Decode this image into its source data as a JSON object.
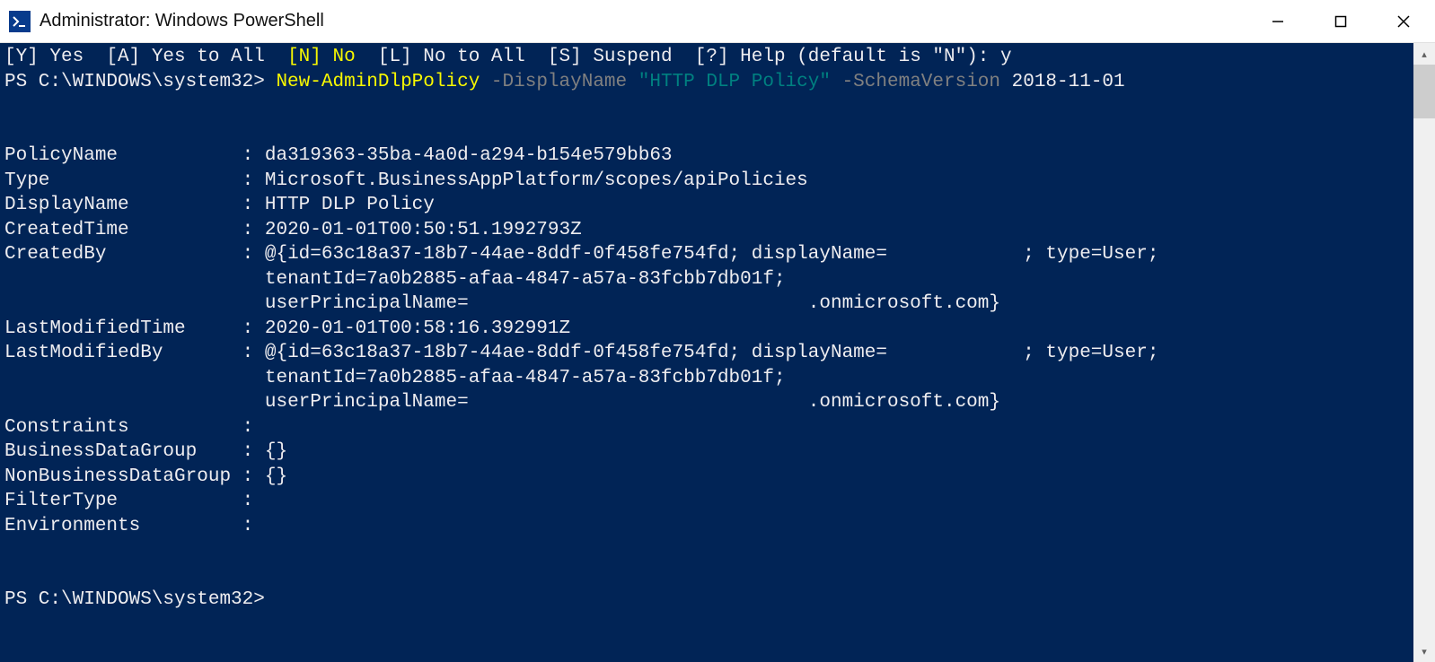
{
  "window": {
    "title": "Administrator: Windows PowerShell"
  },
  "prompt1": {
    "options": "[Y] Yes  [A] Yes to All  ",
    "highlight": "[N] No",
    "rest": "  [L] No to All  [S] Suspend  [?] Help (default is \"N\"): y"
  },
  "cmdline": {
    "prompt": "PS C:\\WINDOWS\\system32> ",
    "cmd": "New-AdminDlpPolicy ",
    "p1": "-DisplayName ",
    "v1": "\"HTTP DLP Policy\" ",
    "p2": "-SchemaVersion ",
    "v2": "2018-11-01"
  },
  "output": {
    "PolicyName": "da319363-35ba-4a0d-a294-b154e579bb63",
    "Type": "Microsoft.BusinessAppPlatform/scopes/apiPolicies",
    "DisplayName": "HTTP DLP Policy",
    "CreatedTime": "2020-01-01T00:50:51.1992793Z",
    "CreatedBy_l1": "@{id=63c18a37-18b7-44ae-8ddf-0f458fe754fd; displayName=            ; type=User;",
    "CreatedBy_l2": "tenantId=7a0b2885-afaa-4847-a57a-83fcbb7db01f;",
    "CreatedBy_l3": "userPrincipalName=                              .onmicrosoft.com}",
    "LastModifiedTime": "2020-01-01T00:58:16.392991Z",
    "LastModifiedBy_l1": "@{id=63c18a37-18b7-44ae-8ddf-0f458fe754fd; displayName=            ; type=User;",
    "LastModifiedBy_l2": "tenantId=7a0b2885-afaa-4847-a57a-83fcbb7db01f;",
    "LastModifiedBy_l3": "userPrincipalName=                              .onmicrosoft.com}",
    "Constraints": "",
    "BusinessDataGroup": "{}",
    "NonBusinessDataGroup": "{}",
    "FilterType": "",
    "Environments": ""
  },
  "labels": {
    "PolicyName": "PolicyName           : ",
    "Type": "Type                 : ",
    "DisplayName": "DisplayName          : ",
    "CreatedTime": "CreatedTime          : ",
    "CreatedBy": "CreatedBy            : ",
    "indent": "                       ",
    "LastModifiedTime": "LastModifiedTime     : ",
    "LastModifiedBy": "LastModifiedBy       : ",
    "Constraints": "Constraints          :",
    "BusinessDataGroup": "BusinessDataGroup    : ",
    "NonBusinessDataGroup": "NonBusinessDataGroup : ",
    "FilterType": "FilterType           :",
    "Environments": "Environments         :"
  },
  "prompt2": "PS C:\\WINDOWS\\system32>"
}
